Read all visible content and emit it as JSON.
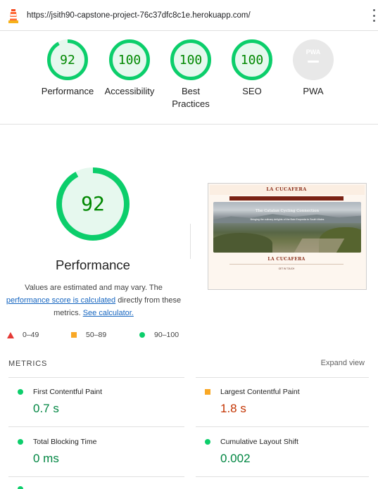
{
  "browser": {
    "url": "https://jsith90-capstone-project-76c37dfc8c1e.herokuapp.com/"
  },
  "summary": [
    {
      "label": "Performance",
      "score": "92",
      "color": "#0cce6b"
    },
    {
      "label": "Accessibility",
      "score": "100",
      "color": "#0cce6b"
    },
    {
      "label": "Best Practices",
      "score": "100",
      "color": "#0cce6b"
    },
    {
      "label": "SEO",
      "score": "100",
      "color": "#0cce6b"
    },
    {
      "label": "PWA",
      "score": "",
      "badge": "PWA",
      "color": "#9e9e9e"
    }
  ],
  "performance": {
    "score": "92",
    "score_fraction": 0.92,
    "title": "Performance",
    "note_prefix": "Values are estimated and may vary. The",
    "note_link": "performance score is calculated",
    "note_mid": "directly from these metrics.",
    "calc_link": "See calculator."
  },
  "legend": [
    {
      "range": "0–49",
      "shape": "triangle",
      "color": "#e53935"
    },
    {
      "range": "50–89",
      "shape": "square",
      "color": "#f9a825"
    },
    {
      "range": "90–100",
      "shape": "circle",
      "color": "#0cce6b"
    }
  ],
  "thumbnail": {
    "brand": "LA CUCAFERA",
    "hero_title": "The Catalan Cycling Connection",
    "hero_subtitle": "Bringing the culinary delights of the Baix Emporda to South Wales",
    "footer_brand": "LA CUCAFERA",
    "footer_heading": "GET IN TOUCH"
  },
  "metrics": {
    "header": "METRICS",
    "expand_label": "Expand view",
    "items": [
      {
        "label": "First Contentful Paint",
        "value": "0.7 s",
        "status": "good"
      },
      {
        "label": "Largest Contentful Paint",
        "value": "1.8 s",
        "status": "average"
      },
      {
        "label": "Total Blocking Time",
        "value": "0 ms",
        "status": "good"
      },
      {
        "label": "Cumulative Layout Shift",
        "value": "0.002",
        "status": "good"
      }
    ]
  }
}
